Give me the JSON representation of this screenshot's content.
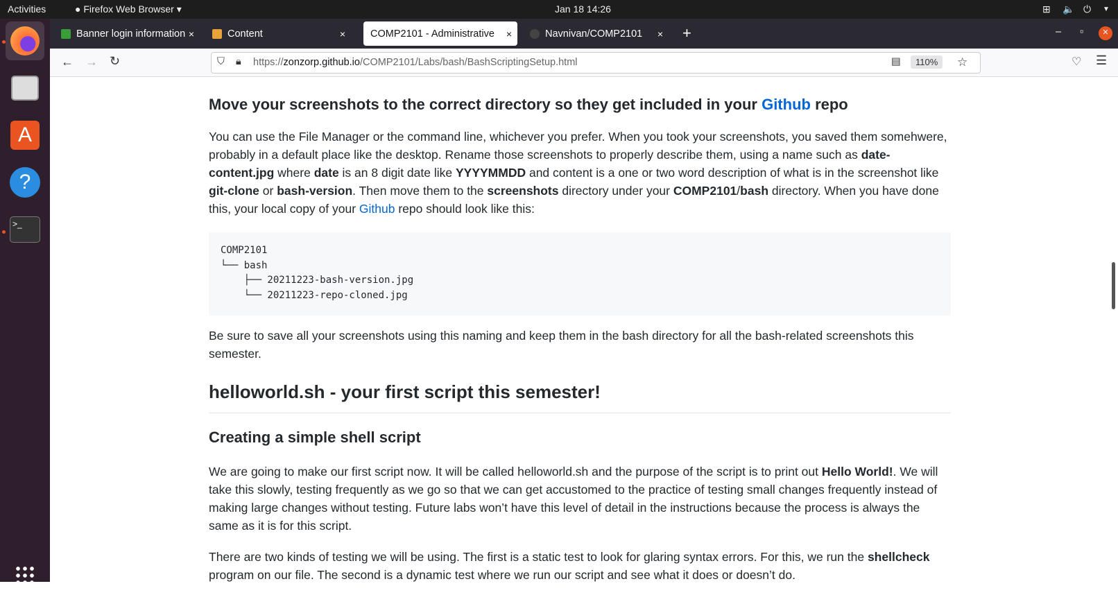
{
  "topbar": {
    "activities": "Activities",
    "app": "Firefox Web Browser ▾",
    "clock": "Jan 18  14:26"
  },
  "tabs": [
    {
      "label": "Banner login information",
      "close": "×",
      "favicon": "#3a9d3a"
    },
    {
      "label": "Content",
      "close": "×",
      "favicon": "#e8a33a"
    },
    {
      "label": "COMP2101 - Administrative",
      "close": "×",
      "active": true
    },
    {
      "label": "Navnivan/COMP2101",
      "close": "×",
      "favicon": "#444"
    }
  ],
  "new_tab": "+",
  "window": {
    "min": "–",
    "max": "▫",
    "close": "×"
  },
  "url": {
    "prefix": "https://",
    "domain": "zonzorp.github.io",
    "path": "/COMP2101/Labs/bash/BashScriptingSetup.html"
  },
  "zoom": "110%",
  "content": {
    "h_move": {
      "a": "Move your screenshots to the correct directory so they get included in your ",
      "link": "Github",
      "b": " repo"
    },
    "p1": [
      {
        "t": "You can use the File Manager or the command line, whichever you prefer. When you took your screenshots, you saved them somehwere, probably in a default place like the desktop. Rename those screenshots to properly describe them, using a name such as "
      },
      {
        "b": "date-content.jpg"
      },
      {
        "t": " where "
      },
      {
        "b": "date"
      },
      {
        "t": " is an 8 digit date like "
      },
      {
        "b": "YYYYMMDD"
      },
      {
        "t": " and content is a one or two word description of what is in the screenshot like "
      },
      {
        "b": "git-clone"
      },
      {
        "t": " or "
      },
      {
        "b": "bash-version"
      },
      {
        "t": ". Then move them to the "
      },
      {
        "b": "screenshots"
      },
      {
        "t": " directory under your "
      },
      {
        "b": "COMP2101"
      },
      {
        "t": "/"
      },
      {
        "b": "bash"
      },
      {
        "t": " directory. When you have done this, your local copy of your "
      },
      {
        "a": "Github"
      },
      {
        "t": " repo should look like this:"
      }
    ],
    "tree": "COMP2101\n└── bash\n    ├── 20211223-bash-version.jpg\n    └── 20211223-repo-cloned.jpg",
    "p2": "Be sure to save all your screenshots using this naming and keep them in the bash directory for all the bash-related screenshots this semester.",
    "h2": "helloworld.sh - your first script this semester!",
    "h3": "Creating a simple shell script",
    "p3": [
      {
        "t": "We are going to make our first script now. It will be called helloworld.sh and the purpose of the script is to print out "
      },
      {
        "b": "Hello World!"
      },
      {
        "t": ". We will take this slowly, testing frequently as we go so that we can get accustomed to the practice of testing small changes frequently instead of making large changes without testing. Future labs won’t have this level of detail in the instructions because the process is always the same as it is for this script."
      }
    ],
    "p4": [
      {
        "t": "There are two kinds of testing we will be using. The first is a static test to look for glaring syntax errors. For this, we run the "
      },
      {
        "b": "shellcheck"
      },
      {
        "t": " program on our file. The second is a dynamic test where we run our script and see what it does or doesn’t do."
      }
    ]
  }
}
